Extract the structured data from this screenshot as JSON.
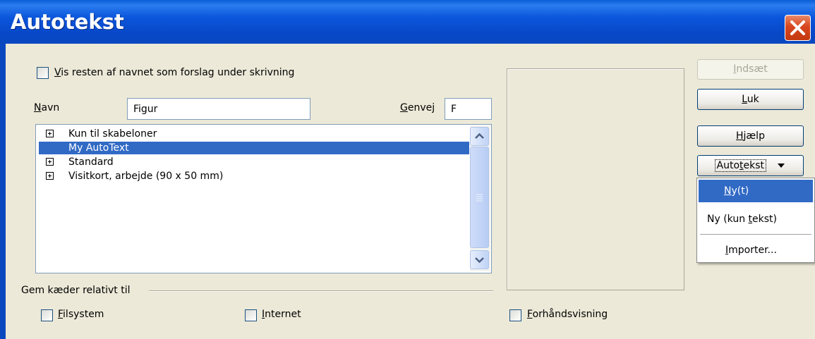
{
  "window": {
    "title": "Autotekst",
    "close_icon": "close-icon"
  },
  "options": {
    "show_remainder_label": "Vis resten af navnet som forslag under skrivning",
    "show_remainder_checked": false
  },
  "name_field": {
    "label": "Navn",
    "value": "Figur"
  },
  "shortcut_field": {
    "label": "Genvej",
    "value": "F"
  },
  "tree": {
    "items": [
      {
        "label": "Kun til skabeloner",
        "expandable": true,
        "selected": false
      },
      {
        "label": "My AutoText",
        "expandable": false,
        "selected": true
      },
      {
        "label": "Standard",
        "expandable": true,
        "selected": false
      },
      {
        "label": "Visitkort, arbejde (90 x 50 mm)",
        "expandable": true,
        "selected": false
      }
    ]
  },
  "save_links": {
    "group_label": "Gem kæder relativt til",
    "filesystem_label": "Filsystem",
    "internet_label": "Internet"
  },
  "preview_toggle": {
    "label": "Forhåndsvisning",
    "checked": false
  },
  "buttons": {
    "insert": "Indsæt",
    "close": "Luk",
    "help": "Hjælp",
    "autotext": "Autotekst"
  },
  "autotext_menu": {
    "items": [
      "Ny(t)",
      "Ny (kun tekst)",
      "Importer..."
    ],
    "highlighted_index": 0
  },
  "colors": {
    "title_bar": "#0a48c0",
    "selection": "#316ac5",
    "close_button": "#d8461e",
    "dialog_background": "#ece9d8"
  }
}
